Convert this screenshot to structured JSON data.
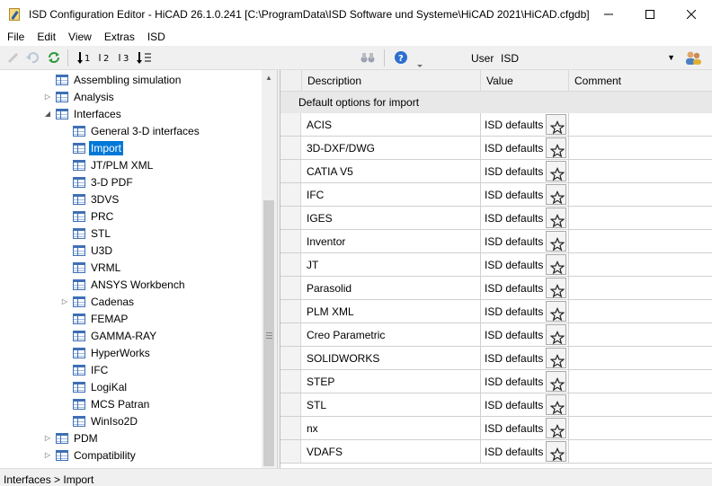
{
  "window": {
    "title": "ISD Configuration Editor  -  HiCAD 26.1.0.241 [C:\\ProgramData\\ISD Software und Systeme\\HiCAD 2021\\HiCAD.cfgdb]"
  },
  "menu": [
    "File",
    "Edit",
    "View",
    "Extras",
    "ISD"
  ],
  "toolbar": {
    "user_label": "User",
    "user_value": "ISD"
  },
  "tree": [
    {
      "label": "Assembling simulation",
      "level": 1,
      "toggle": "",
      "selected": false
    },
    {
      "label": "Analysis",
      "level": 1,
      "toggle": "collapsed",
      "selected": false
    },
    {
      "label": "Interfaces",
      "level": 1,
      "toggle": "expanded",
      "selected": false
    },
    {
      "label": "General 3-D interfaces",
      "level": 2,
      "toggle": "",
      "selected": false
    },
    {
      "label": "Import",
      "level": 2,
      "toggle": "",
      "selected": true
    },
    {
      "label": "JT/PLM XML",
      "level": 2,
      "toggle": "",
      "selected": false
    },
    {
      "label": "3-D PDF",
      "level": 2,
      "toggle": "",
      "selected": false
    },
    {
      "label": "3DVS",
      "level": 2,
      "toggle": "",
      "selected": false
    },
    {
      "label": "PRC",
      "level": 2,
      "toggle": "",
      "selected": false
    },
    {
      "label": "STL",
      "level": 2,
      "toggle": "",
      "selected": false
    },
    {
      "label": "U3D",
      "level": 2,
      "toggle": "",
      "selected": false
    },
    {
      "label": "VRML",
      "level": 2,
      "toggle": "",
      "selected": false
    },
    {
      "label": "ANSYS Workbench",
      "level": 2,
      "toggle": "",
      "selected": false
    },
    {
      "label": "Cadenas",
      "level": 2,
      "toggle": "collapsed",
      "selected": false
    },
    {
      "label": "FEMAP",
      "level": 2,
      "toggle": "",
      "selected": false
    },
    {
      "label": "GAMMA-RAY",
      "level": 2,
      "toggle": "",
      "selected": false
    },
    {
      "label": "HyperWorks",
      "level": 2,
      "toggle": "",
      "selected": false
    },
    {
      "label": "IFC",
      "level": 2,
      "toggle": "",
      "selected": false
    },
    {
      "label": "LogiKal",
      "level": 2,
      "toggle": "",
      "selected": false
    },
    {
      "label": "MCS Patran",
      "level": 2,
      "toggle": "",
      "selected": false
    },
    {
      "label": "WinIso2D",
      "level": 2,
      "toggle": "",
      "selected": false
    },
    {
      "label": "PDM",
      "level": 1,
      "toggle": "collapsed",
      "selected": false
    },
    {
      "label": "Compatibility",
      "level": 1,
      "toggle": "collapsed",
      "selected": false
    }
  ],
  "grid": {
    "columns": [
      "Description",
      "Value",
      "Comment"
    ],
    "group": "Default options for import",
    "rows": [
      {
        "description": "ACIS",
        "value": "ISD defaults"
      },
      {
        "description": "3D-DXF/DWG",
        "value": "ISD defaults"
      },
      {
        "description": "CATIA V5",
        "value": "ISD defaults"
      },
      {
        "description": "IFC",
        "value": "ISD defaults"
      },
      {
        "description": "IGES",
        "value": "ISD defaults"
      },
      {
        "description": "Inventor",
        "value": "ISD defaults"
      },
      {
        "description": "JT",
        "value": "ISD defaults"
      },
      {
        "description": "Parasolid",
        "value": "ISD defaults"
      },
      {
        "description": "PLM XML",
        "value": "ISD defaults"
      },
      {
        "description": "Creo Parametric",
        "value": "ISD defaults"
      },
      {
        "description": "SOLIDWORKS",
        "value": "ISD defaults"
      },
      {
        "description": "STEP",
        "value": "ISD defaults"
      },
      {
        "description": "STL",
        "value": "ISD defaults"
      },
      {
        "description": "nx",
        "value": "ISD defaults"
      },
      {
        "description": "VDAFS",
        "value": "ISD defaults"
      }
    ]
  },
  "status": {
    "path": "Interfaces > Import"
  },
  "colors": {
    "selection": "#0078d7",
    "icon_blue": "#3f6fb5"
  }
}
